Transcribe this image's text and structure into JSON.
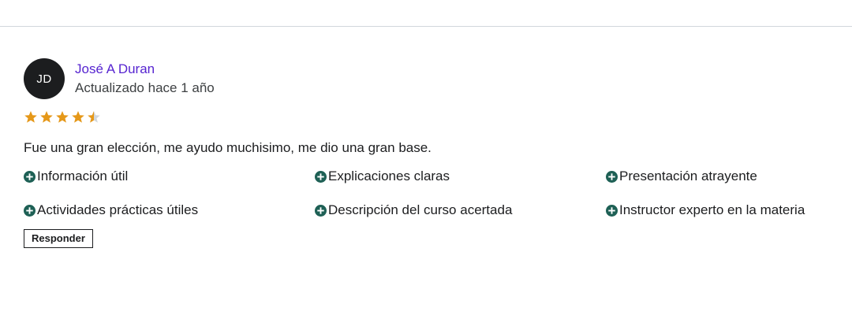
{
  "review": {
    "avatar_initials": "JD",
    "author": "José A Duran",
    "updated": "Actualizado hace 1 año",
    "rating": 4.5,
    "rating_max": 5,
    "comment": "Fue una gran elección, me ayudo muchisimo, me dio una gran base.",
    "tags": [
      "Información útil",
      "Explicaciones claras",
      "Presentación atrayente",
      "Actividades prácticas útiles",
      "Descripción del curso acertada",
      "Instructor experto en la materia"
    ],
    "tag_icon": "plus-circle-icon",
    "reply_label": "Responder"
  },
  "colors": {
    "author": "#5624d0",
    "star": "#e59819",
    "star_empty": "#d1d7dc",
    "tag_icon": "#1e6055"
  }
}
